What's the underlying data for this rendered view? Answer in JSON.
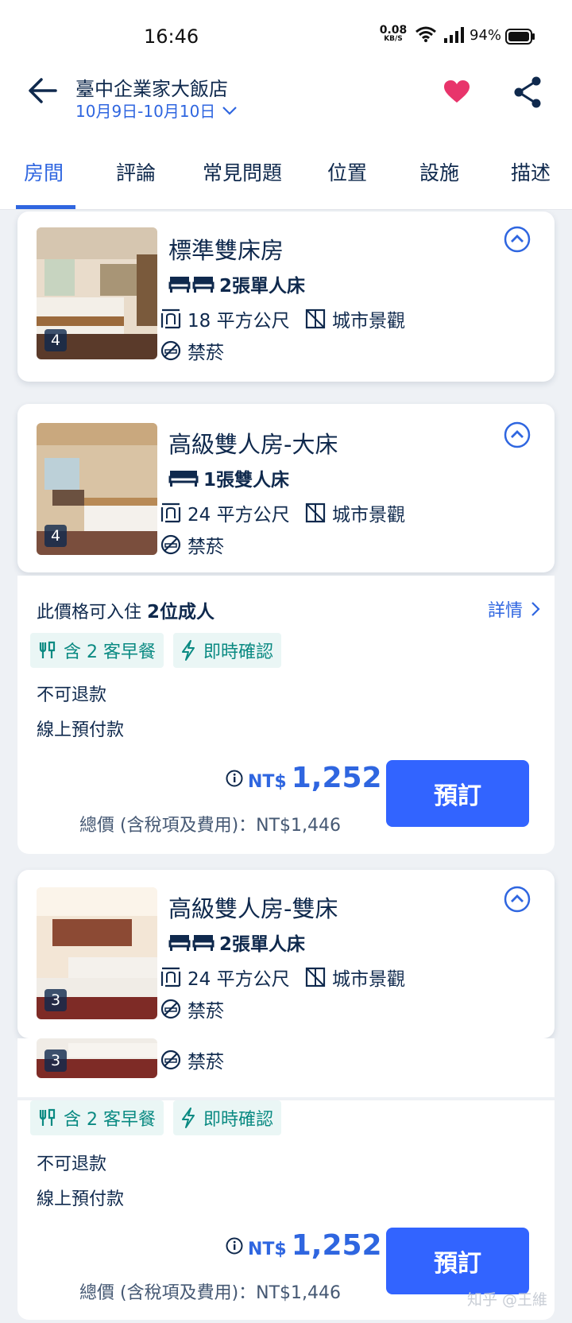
{
  "status": {
    "time": "16:46",
    "net_value": "0.08",
    "net_unit": "KB/S",
    "battery": "94%"
  },
  "header": {
    "hotel_name": "臺中企業家大飯店",
    "dates": "10月9日-10月10日"
  },
  "tabs": [
    "房間",
    "評論",
    "常見問題",
    "位置",
    "設施",
    "描述"
  ],
  "rooms": [
    {
      "title": "標準雙床房",
      "bed": "2張單人床",
      "area": "18 平方公尺",
      "view": "城市景觀",
      "smoking": "禁菸",
      "photos": "4"
    },
    {
      "title": "高級雙人房-大床",
      "bed": "1張雙人床",
      "area": "24 平方公尺",
      "view": "城市景觀",
      "smoking": "禁菸",
      "photos": "4"
    },
    {
      "title": "高級雙人房-雙床",
      "bed": "2張單人床",
      "area": "24 平方公尺",
      "view": "城市景觀",
      "smoking": "禁菸",
      "photos": "3"
    }
  ],
  "rate1": {
    "occupancy_prefix": "此價格可入住 ",
    "occupancy": "2位成人",
    "details": "詳情",
    "breakfast": "含 2 客早餐",
    "instant": "即時確認",
    "refund": "不可退款",
    "payment": "線上預付款",
    "currency": "NT$",
    "price": "1,252",
    "total": "總價 (含稅項及費用)：NT$1,446",
    "book": "預訂"
  },
  "peek": {
    "smoking": "禁菸",
    "photos": "3"
  },
  "rate2": {
    "breakfast": "含 2 客早餐",
    "instant": "即時確認",
    "refund": "不可退款",
    "payment": "線上預付款",
    "currency": "NT$",
    "price": "1,252",
    "total": "總價 (含稅項及費用)：NT$1,446",
    "book": "預訂"
  },
  "watermark": "知乎 @王維",
  "colors": {
    "accent": "#2f66e0",
    "button": "#3264ff",
    "heart": "#e8346b",
    "tag_bg": "#eaf6f5",
    "tag_text": "#0a8a82"
  }
}
